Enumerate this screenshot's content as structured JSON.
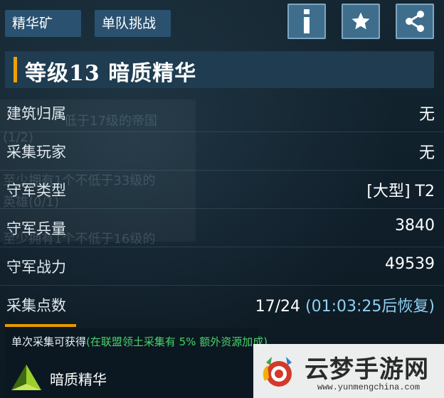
{
  "header": {
    "tabs": [
      {
        "label": "精华矿"
      },
      {
        "label": "单队挑战"
      }
    ],
    "icons": [
      "info-icon",
      "star-icon",
      "share-icon"
    ]
  },
  "title": "等级13  暗质精华",
  "ghost_texts": [
    "低于17级的帝国",
    "(1/2)",
    "至少拥有1个不低于33级的",
    "英雄(0/1)",
    "至少拥有1个不低于16级的"
  ],
  "details": [
    {
      "label": "建筑归属",
      "value": "无"
    },
    {
      "label": "采集玩家",
      "value": "无"
    },
    {
      "label": "守军类型",
      "value": "[大型] T2"
    },
    {
      "label": "守军兵量",
      "value": "3840"
    },
    {
      "label": "守军战力",
      "value": "49539"
    }
  ],
  "collect": {
    "label": "采集点数",
    "count": "17/24",
    "recover": "(01:03:25后恢复)"
  },
  "gain": {
    "prefix": "单次采集可获得",
    "bonus": "(在联盟领土采集有 5% 额外资源加成)"
  },
  "reward": {
    "name": "暗质精华"
  },
  "watermark": {
    "title": "云梦手游网",
    "url": "www.yunmengchina.com"
  },
  "colors": {
    "accent_orange": "#f0a000",
    "tab_blue": "#2a5170",
    "bonus_green": "#46d36a",
    "recover_blue": "#8fd0f0"
  }
}
